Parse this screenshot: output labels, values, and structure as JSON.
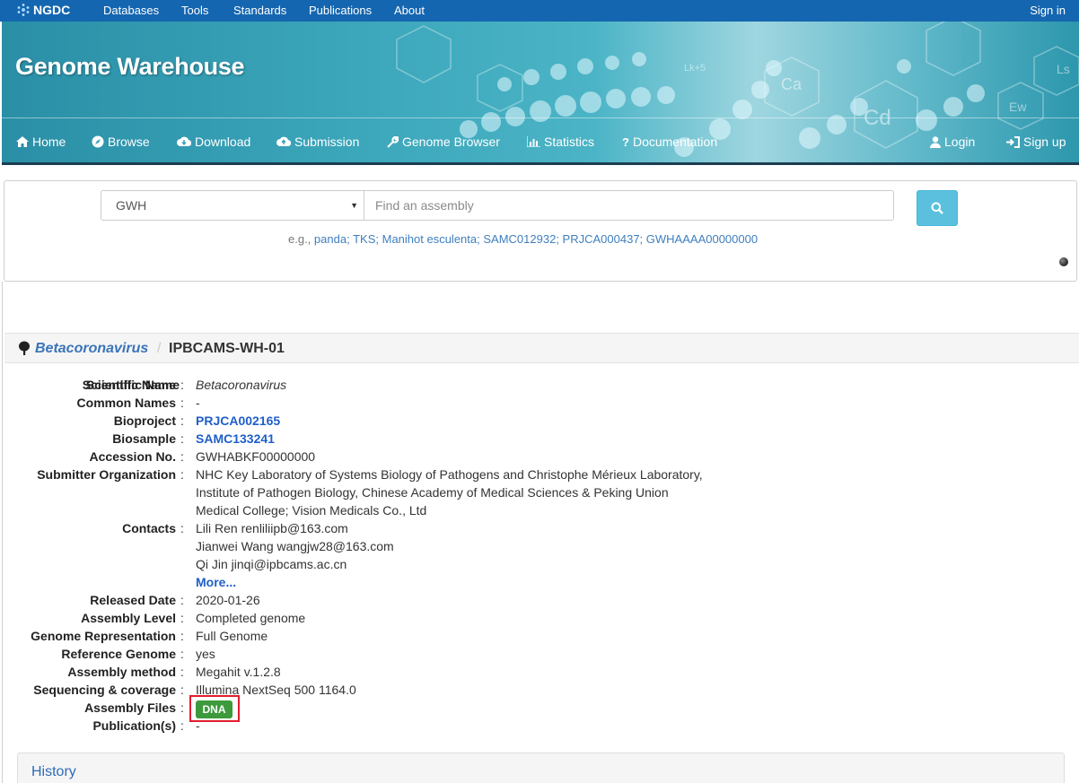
{
  "topnav": {
    "brand": "NGDC",
    "items": [
      "Databases",
      "Tools",
      "Standards",
      "Publications",
      "About"
    ],
    "signin": "Sign in"
  },
  "banner": {
    "title": "Genome Warehouse"
  },
  "subnav": {
    "home": "Home",
    "browse": "Browse",
    "download": "Download",
    "submission": "Submission",
    "genome_browser": "Genome Browser",
    "statistics": "Statistics",
    "documentation": "Documentation",
    "login": "Login",
    "signup": "Sign up"
  },
  "search": {
    "selected_db": "GWH",
    "placeholder": "Find an assembly",
    "examples_prefix": "e.g.,",
    "examples": [
      "panda",
      "TKS",
      "Manihot esculenta",
      "SAMC012932",
      "PRJCA000437",
      "GWHAAAA00000000"
    ]
  },
  "breadcrumb": {
    "genus": "Betacoronavirus",
    "separator": "/",
    "strain": "IPBCAMS-WH-01"
  },
  "details": {
    "colon": ":",
    "scientific_name_label": "Scientific Name",
    "scientific_name": "Betacoronavirus",
    "common_names_label": "Common Names",
    "common_names": "-",
    "bioproject_label": "Bioproject",
    "bioproject": "PRJCA002165",
    "biosample_label": "Biosample",
    "biosample": "SAMC133241",
    "accession_label": "Accession No.",
    "accession": "GWHABKF00000000",
    "submitter_org_label": "Submitter Organization",
    "submitter_org_lines": [
      "NHC Key Laboratory of Systems Biology of Pathogens and Christophe Mérieux Laboratory,",
      "Institute of Pathogen Biology, Chinese Academy of Medical Sciences & Peking Union",
      "Medical College; Vision Medicals Co., Ltd"
    ],
    "contacts_label": "Contacts",
    "contacts": [
      "Lili Ren renliliipb@163.com",
      "Jianwei Wang wangjw28@163.com",
      "Qi Jin jinqi@ipbcams.ac.cn"
    ],
    "more": "More...",
    "released_date_label": "Released Date",
    "released_date": "2020-01-26",
    "assembly_level_label": "Assembly Level",
    "assembly_level": "Completed genome",
    "genome_rep_label": "Genome Representation",
    "genome_rep": "Full Genome",
    "reference_label": "Reference Genome",
    "reference": "yes",
    "assembly_method_label": "Assembly method",
    "assembly_method": "Megahit v.1.2.8",
    "sequencing_label": "Sequencing & coverage",
    "sequencing": "Illumina NextSeq 500 1164.0",
    "assembly_files_label": "Assembly Files",
    "dna_button": "DNA",
    "publications_label": "Publication(s)",
    "publications": "-"
  },
  "history": {
    "title": "History"
  },
  "colors": {
    "topbar": "#1566b0",
    "link": "#3f7fbf",
    "bold_link": "#1f5fc8",
    "dna_button": "#3c9a3c",
    "highlight": "#e21d2e",
    "search_button": "#5bc0de"
  }
}
